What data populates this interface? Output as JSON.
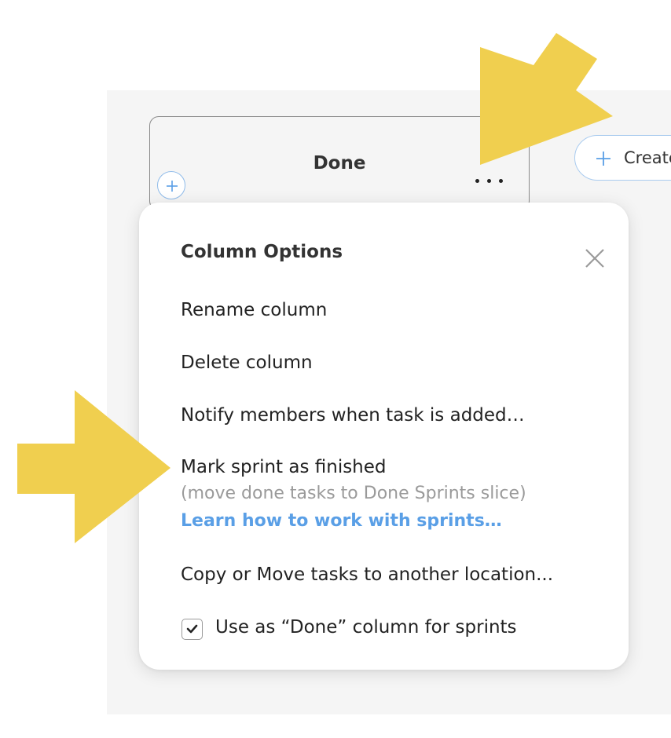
{
  "column": {
    "title": "Done"
  },
  "toolbar": {
    "create_label": "Create"
  },
  "popup": {
    "title": "Column Options",
    "items": {
      "rename": "Rename column",
      "delete": "Delete column",
      "notify": "Notify members when task is added…",
      "mark_finished": "Mark sprint as finished",
      "mark_finished_sub": "(move done tasks to Done Sprints slice)",
      "learn_link": "Learn how to work with sprints…",
      "copy_move": "Copy or Move tasks to another location..."
    },
    "done_checkbox": {
      "label": "Use as “Done” column for sprints",
      "checked": true
    }
  },
  "colors": {
    "accent_blue": "#5a9fe6",
    "arrow_yellow": "#f0cf4f",
    "board_background": "#f5f5f5"
  },
  "icons": {
    "add": "plus-icon",
    "more": "ellipsis-icon",
    "close": "close-icon",
    "check": "check-icon",
    "annotation": "arrow-icon"
  }
}
